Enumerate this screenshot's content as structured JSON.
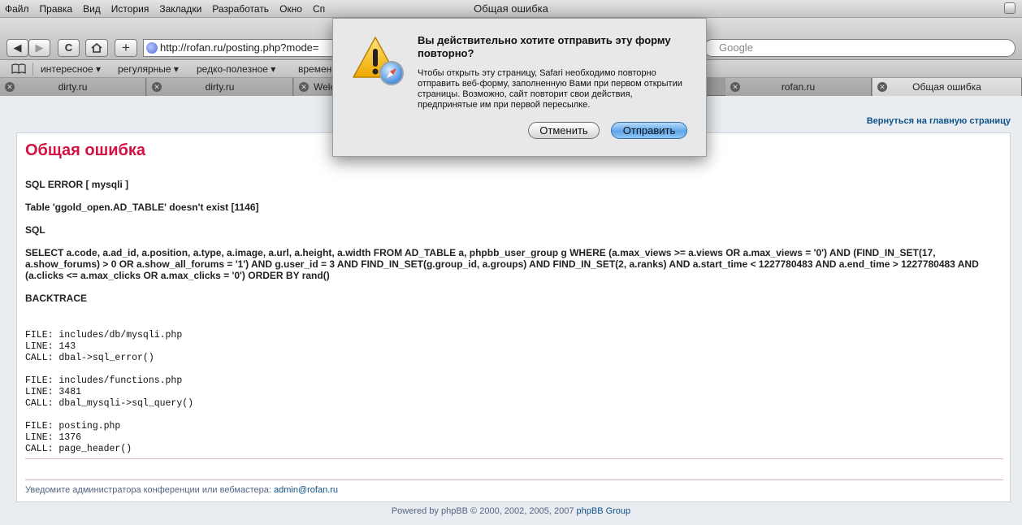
{
  "window": {
    "title": "Общая ошибка"
  },
  "menu": [
    "Файл",
    "Правка",
    "Вид",
    "История",
    "Закладки",
    "Разработать",
    "Окно",
    "Сп"
  ],
  "toolbar": {
    "back_label": "◀",
    "forward_label": "▶",
    "reload_label": "C",
    "add_label": "+",
    "url": "http://rofan.ru/posting.php?mode=",
    "search_placeholder": "Google"
  },
  "bookmarks": [
    "интересное ▾",
    "регулярные ▾",
    "редко-полезное ▾",
    "времен"
  ],
  "tabs": [
    {
      "label": "dirty.ru",
      "active": false
    },
    {
      "label": "dirty.ru",
      "active": false
    },
    {
      "label": "Welc",
      "active": false
    },
    {
      "label": "rofan.ru",
      "active": false
    },
    {
      "label": "Общая ошибка",
      "active": true
    }
  ],
  "page": {
    "home_link": "Вернуться на главную страницу",
    "error_title": "Общая ошибка",
    "sql_error": "SQL ERROR [ mysqli ]",
    "table_msg": "Table 'ggold_open.AD_TABLE' doesn't exist [1146]",
    "sql_label": "SQL",
    "sql_query": "SELECT a.code, a.ad_id, a.position, a.type, a.image, a.url, a.height, a.width FROM AD_TABLE a, phpbb_user_group g WHERE (a.max_views >= a.views OR a.max_views = '0') AND (FIND_IN_SET(17, a.show_forums) > 0 OR a.show_all_forums = '1') AND g.user_id = 3 AND FIND_IN_SET(g.group_id, a.groups) AND FIND_IN_SET(2, a.ranks) AND a.start_time < 1227780483 AND a.end_time > 1227780483 AND (a.clicks <= a.max_clicks OR a.max_clicks = '0') ORDER BY rand()",
    "backtrace_label": "BACKTRACE",
    "backtrace": [
      "FILE: includes/db/mysqli.php\nLINE: 143\nCALL: dbal->sql_error()",
      "FILE: includes/functions.php\nLINE: 3481\nCALL: dbal_mysqli->sql_query()",
      "FILE: posting.php\nLINE: 1376\nCALL: page_header()"
    ],
    "notify_text": "Уведомите администратора конференции или вебмастера:",
    "notify_email": "admin@rofan.ru",
    "powered_text": "Powered by phpBB © 2000, 2002, 2005, 2007",
    "powered_link": "phpBB Group"
  },
  "dialog": {
    "heading": "Вы действительно хотите отправить эту форму повторно?",
    "body": "Чтобы открыть эту страницу, Safari необходимо повторно отправить веб-форму, заполненную Вами при первом открытии страницы. Возможно, сайт повторит свои действия, предпринятые им при первой пересылке.",
    "cancel_label": "Отменить",
    "submit_label": "Отправить"
  }
}
